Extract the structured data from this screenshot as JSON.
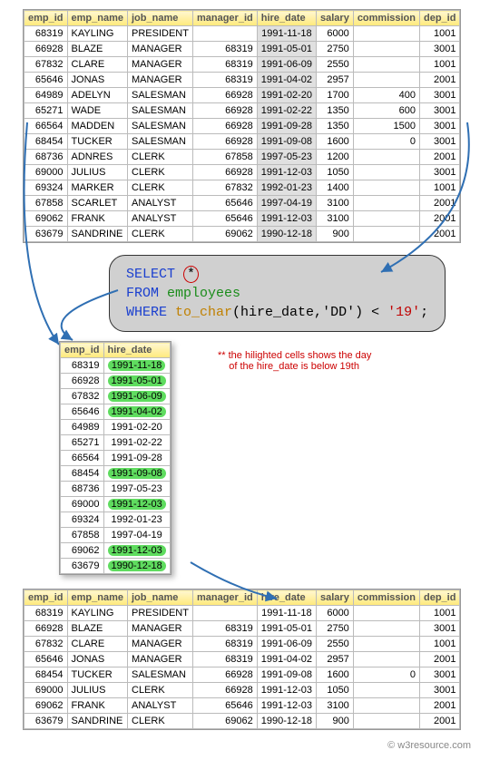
{
  "columns": [
    "emp_id",
    "emp_name",
    "job_name",
    "manager_id",
    "hire_date",
    "salary",
    "commission",
    "dep_id"
  ],
  "employees": [
    {
      "emp_id": 68319,
      "emp_name": "KAYLING",
      "job_name": "PRESIDENT",
      "manager_id": "",
      "hire_date": "1991-11-18",
      "salary": 6000,
      "commission": "",
      "dep_id": 1001
    },
    {
      "emp_id": 66928,
      "emp_name": "BLAZE",
      "job_name": "MANAGER",
      "manager_id": 68319,
      "hire_date": "1991-05-01",
      "salary": 2750,
      "commission": "",
      "dep_id": 3001
    },
    {
      "emp_id": 67832,
      "emp_name": "CLARE",
      "job_name": "MANAGER",
      "manager_id": 68319,
      "hire_date": "1991-06-09",
      "salary": 2550,
      "commission": "",
      "dep_id": 1001
    },
    {
      "emp_id": 65646,
      "emp_name": "JONAS",
      "job_name": "MANAGER",
      "manager_id": 68319,
      "hire_date": "1991-04-02",
      "salary": 2957,
      "commission": "",
      "dep_id": 2001
    },
    {
      "emp_id": 64989,
      "emp_name": "ADELYN",
      "job_name": "SALESMAN",
      "manager_id": 66928,
      "hire_date": "1991-02-20",
      "salary": 1700,
      "commission": 400,
      "dep_id": 3001
    },
    {
      "emp_id": 65271,
      "emp_name": "WADE",
      "job_name": "SALESMAN",
      "manager_id": 66928,
      "hire_date": "1991-02-22",
      "salary": 1350,
      "commission": 600,
      "dep_id": 3001
    },
    {
      "emp_id": 66564,
      "emp_name": "MADDEN",
      "job_name": "SALESMAN",
      "manager_id": 66928,
      "hire_date": "1991-09-28",
      "salary": 1350,
      "commission": 1500,
      "dep_id": 3001
    },
    {
      "emp_id": 68454,
      "emp_name": "TUCKER",
      "job_name": "SALESMAN",
      "manager_id": 66928,
      "hire_date": "1991-09-08",
      "salary": 1600,
      "commission": 0,
      "dep_id": 3001
    },
    {
      "emp_id": 68736,
      "emp_name": "ADNRES",
      "job_name": "CLERK",
      "manager_id": 67858,
      "hire_date": "1997-05-23",
      "salary": 1200,
      "commission": "",
      "dep_id": 2001
    },
    {
      "emp_id": 69000,
      "emp_name": "JULIUS",
      "job_name": "CLERK",
      "manager_id": 66928,
      "hire_date": "1991-12-03",
      "salary": 1050,
      "commission": "",
      "dep_id": 3001
    },
    {
      "emp_id": 69324,
      "emp_name": "MARKER",
      "job_name": "CLERK",
      "manager_id": 67832,
      "hire_date": "1992-01-23",
      "salary": 1400,
      "commission": "",
      "dep_id": 1001
    },
    {
      "emp_id": 67858,
      "emp_name": "SCARLET",
      "job_name": "ANALYST",
      "manager_id": 65646,
      "hire_date": "1997-04-19",
      "salary": 3100,
      "commission": "",
      "dep_id": 2001
    },
    {
      "emp_id": 69062,
      "emp_name": "FRANK",
      "job_name": "ANALYST",
      "manager_id": 65646,
      "hire_date": "1991-12-03",
      "salary": 3100,
      "commission": "",
      "dep_id": 2001
    },
    {
      "emp_id": 63679,
      "emp_name": "SANDRINE",
      "job_name": "CLERK",
      "manager_id": 69062,
      "hire_date": "1990-12-18",
      "salary": 900,
      "commission": "",
      "dep_id": 2001
    }
  ],
  "sql": {
    "select": "SELECT",
    "star": "*",
    "from": "FROM",
    "table": "employees",
    "where": "WHERE",
    "fn": "to_char",
    "args": "(hire_date,'DD')",
    "op": " < ",
    "val": "'19'",
    "semi": ";"
  },
  "mid_columns": [
    "emp_id",
    "hire_date"
  ],
  "mid_rows": [
    {
      "emp_id": 68319,
      "hire_date": "1991-11-18",
      "hl": true
    },
    {
      "emp_id": 66928,
      "hire_date": "1991-05-01",
      "hl": true
    },
    {
      "emp_id": 67832,
      "hire_date": "1991-06-09",
      "hl": true
    },
    {
      "emp_id": 65646,
      "hire_date": "1991-04-02",
      "hl": true
    },
    {
      "emp_id": 64989,
      "hire_date": "1991-02-20",
      "hl": false
    },
    {
      "emp_id": 65271,
      "hire_date": "1991-02-22",
      "hl": false
    },
    {
      "emp_id": 66564,
      "hire_date": "1991-09-28",
      "hl": false
    },
    {
      "emp_id": 68454,
      "hire_date": "1991-09-08",
      "hl": true
    },
    {
      "emp_id": 68736,
      "hire_date": "1997-05-23",
      "hl": false
    },
    {
      "emp_id": 69000,
      "hire_date": "1991-12-03",
      "hl": true
    },
    {
      "emp_id": 69324,
      "hire_date": "1992-01-23",
      "hl": false
    },
    {
      "emp_id": 67858,
      "hire_date": "1997-04-19",
      "hl": false
    },
    {
      "emp_id": 69062,
      "hire_date": "1991-12-03",
      "hl": true
    },
    {
      "emp_id": 63679,
      "hire_date": "1990-12-18",
      "hl": true
    }
  ],
  "note_line1": "** the hilighted cells shows the day",
  "note_line2": "    of the hire_date is below 19th",
  "result": [
    {
      "emp_id": 68319,
      "emp_name": "KAYLING",
      "job_name": "PRESIDENT",
      "manager_id": "",
      "hire_date": "1991-11-18",
      "salary": 6000,
      "commission": "",
      "dep_id": 1001
    },
    {
      "emp_id": 66928,
      "emp_name": "BLAZE",
      "job_name": "MANAGER",
      "manager_id": 68319,
      "hire_date": "1991-05-01",
      "salary": 2750,
      "commission": "",
      "dep_id": 3001
    },
    {
      "emp_id": 67832,
      "emp_name": "CLARE",
      "job_name": "MANAGER",
      "manager_id": 68319,
      "hire_date": "1991-06-09",
      "salary": 2550,
      "commission": "",
      "dep_id": 1001
    },
    {
      "emp_id": 65646,
      "emp_name": "JONAS",
      "job_name": "MANAGER",
      "manager_id": 68319,
      "hire_date": "1991-04-02",
      "salary": 2957,
      "commission": "",
      "dep_id": 2001
    },
    {
      "emp_id": 68454,
      "emp_name": "TUCKER",
      "job_name": "SALESMAN",
      "manager_id": 66928,
      "hire_date": "1991-09-08",
      "salary": 1600,
      "commission": 0,
      "dep_id": 3001
    },
    {
      "emp_id": 69000,
      "emp_name": "JULIUS",
      "job_name": "CLERK",
      "manager_id": 66928,
      "hire_date": "1991-12-03",
      "salary": 1050,
      "commission": "",
      "dep_id": 3001
    },
    {
      "emp_id": 69062,
      "emp_name": "FRANK",
      "job_name": "ANALYST",
      "manager_id": 65646,
      "hire_date": "1991-12-03",
      "salary": 3100,
      "commission": "",
      "dep_id": 2001
    },
    {
      "emp_id": 63679,
      "emp_name": "SANDRINE",
      "job_name": "CLERK",
      "manager_id": 69062,
      "hire_date": "1990-12-18",
      "salary": 900,
      "commission": "",
      "dep_id": 2001
    }
  ],
  "footer": "© w3resource.com"
}
